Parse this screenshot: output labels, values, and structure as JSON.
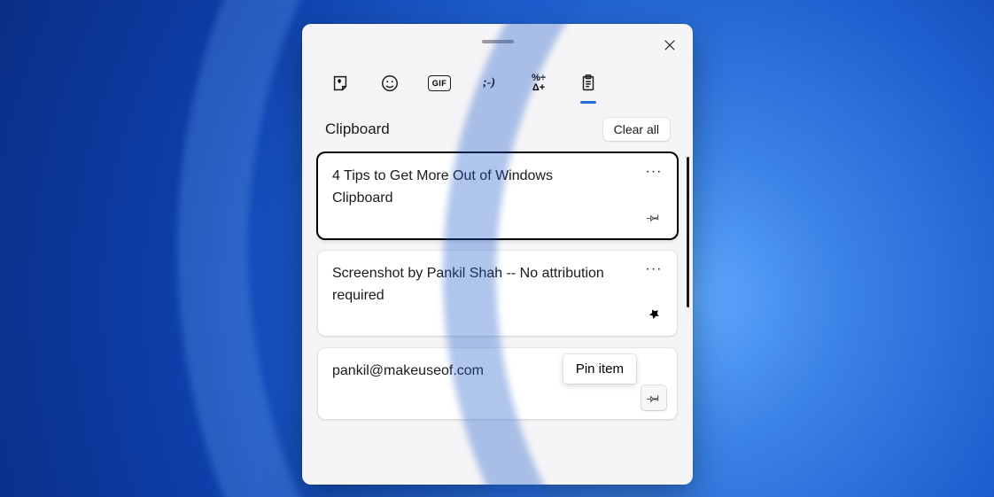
{
  "panel": {
    "tabs": {
      "gif_label": "GIF",
      "kaomoji_label": ";-)",
      "symbols_label": "%÷\nΔ+"
    },
    "section_title": "Clipboard",
    "clear_all_label": "Clear all"
  },
  "items": [
    {
      "text": "4 Tips to Get More Out of Windows Clipboard",
      "pinned": false,
      "selected": true
    },
    {
      "text": "Screenshot by Pankil Shah -- No attribution required",
      "pinned": true,
      "selected": false
    },
    {
      "text": "pankil@makeuseof.com",
      "pinned": false,
      "selected": false
    }
  ],
  "tooltip": "Pin item"
}
